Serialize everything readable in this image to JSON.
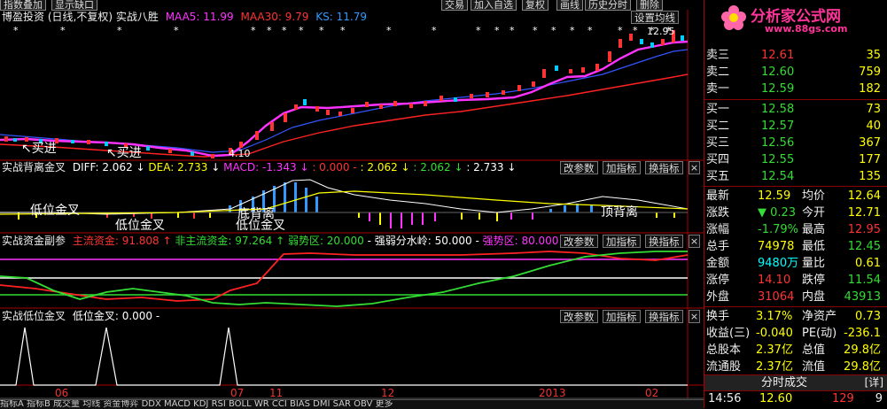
{
  "top_tabs": [
    "指数叠加",
    "显示缺口"
  ],
  "top_right_tabs": [
    "交易",
    "加入自选",
    "复权",
    "画线",
    "历史分时",
    "删除"
  ],
  "main_chart": {
    "title": "博盈投资",
    "subtitle": "(日线,不复权)",
    "indicator": "实战八胜",
    "ma5": "MAA5: 11.99",
    "ma30": "MAA30: 9.79",
    "ks": "KS: 11.79",
    "settings_button": "设置均线",
    "annotations": {
      "buy1": "↖买进",
      "buy2": "↖买进",
      "low_price": "4.10",
      "high_price": "12.95"
    },
    "colors": {
      "ma5": "#ff33ff",
      "ma30": "#ff2222",
      "ks": "#3399ff"
    }
  },
  "panel2": {
    "name": "实战背离金叉",
    "diff": "DIFF: 2.062",
    "dea": "DEA: 2.733",
    "macd": "MACD: -1.343",
    "v1": ": 0.000",
    "v2": ": 2.062",
    "v3": ": 2.062",
    "v4": ": 2.733",
    "ann": {
      "a1": "低位金叉",
      "a2": "低位金叉",
      "a3": "底背离",
      "a4": "低位金叉",
      "a5": "顶背离"
    }
  },
  "panel3": {
    "name": "实战资金副参",
    "main": "主流资金: 91.808",
    "nonmain": "非主流资金: 97.264",
    "weak": "弱势区: 20.000",
    "water": "强弱分水岭: 50.000",
    "strong": "强势区: 80.000"
  },
  "panel4": {
    "name": "实战低位金叉",
    "value": "低位金叉: 0.000"
  },
  "panel_buttons": {
    "change": "改参数",
    "add": "加指标",
    "switch": "换指标",
    "close": "×"
  },
  "x_axis": [
    "06",
    "07",
    "11",
    "12",
    "2013",
    "02"
  ],
  "bottom_tabs": "指标A  指标B  成交量  均线  资金博弈  DDX  MACD  KDJ  RSI  BOLL  WR  CCI  BIAS  DMI  SAR  OBV  更多",
  "quote": {
    "logo": "分析家公式网",
    "logo_url": "www.88gs.com",
    "sell": [
      {
        "label": "卖三",
        "price": "12.61",
        "vol": "35"
      },
      {
        "label": "卖二",
        "price": "12.60",
        "vol": "759"
      },
      {
        "label": "卖一",
        "price": "12.59",
        "vol": "182"
      }
    ],
    "buy": [
      {
        "label": "买一",
        "price": "12.58",
        "vol": "73"
      },
      {
        "label": "买二",
        "price": "12.57",
        "vol": "40"
      },
      {
        "label": "买三",
        "price": "12.56",
        "vol": "367"
      },
      {
        "label": "买四",
        "price": "12.55",
        "vol": "177"
      },
      {
        "label": "买五",
        "price": "12.54",
        "vol": "135"
      }
    ],
    "stats": [
      {
        "l1": "最新",
        "v1": "12.59",
        "l2": "均价",
        "v2": "12.64",
        "c1": "#ffff00",
        "c2": "#ffff00"
      },
      {
        "l1": "涨跌",
        "v1": "▼ 0.23",
        "l2": "今开",
        "v2": "12.71",
        "c1": "#33dd33",
        "c2": "#ffff00"
      },
      {
        "l1": "涨幅",
        "v1": "-1.79%",
        "l2": "最高",
        "v2": "12.95",
        "c1": "#33dd33",
        "c2": "#ff3333"
      },
      {
        "l1": "总手",
        "v1": "74978",
        "l2": "最低",
        "v2": "12.45",
        "c1": "#ffff00",
        "c2": "#33dd33"
      },
      {
        "l1": "金额",
        "v1": "9480万",
        "l2": "量比",
        "v2": "0.61",
        "c1": "#00ffff",
        "c2": "#ffff00"
      },
      {
        "l1": "涨停",
        "v1": "14.10",
        "l2": "跌停",
        "v2": "11.54",
        "c1": "#ff3333",
        "c2": "#33dd33"
      },
      {
        "l1": "外盘",
        "v1": "31064",
        "l2": "内盘",
        "v2": "43913",
        "c1": "#ff3333",
        "c2": "#33dd33"
      }
    ],
    "fin": [
      {
        "l1": "换手",
        "v1": "3.17%",
        "l2": "净资产",
        "v2": "0.73"
      },
      {
        "l1": "收益(三)",
        "v1": "-0.040",
        "l2": "PE(动)",
        "v2": "-236.1"
      },
      {
        "l1": "总股本",
        "v1": "2.37亿",
        "l2": "总值",
        "v2": "29.8亿"
      },
      {
        "l1": "流通股",
        "v1": "2.37亿",
        "l2": "流值",
        "v2": "29.8亿"
      }
    ],
    "tick_header": "分时成交",
    "tick_detail": "详",
    "tick": {
      "time": "14:56",
      "price": "12.60",
      "vol": "129",
      "num": "9"
    }
  }
}
